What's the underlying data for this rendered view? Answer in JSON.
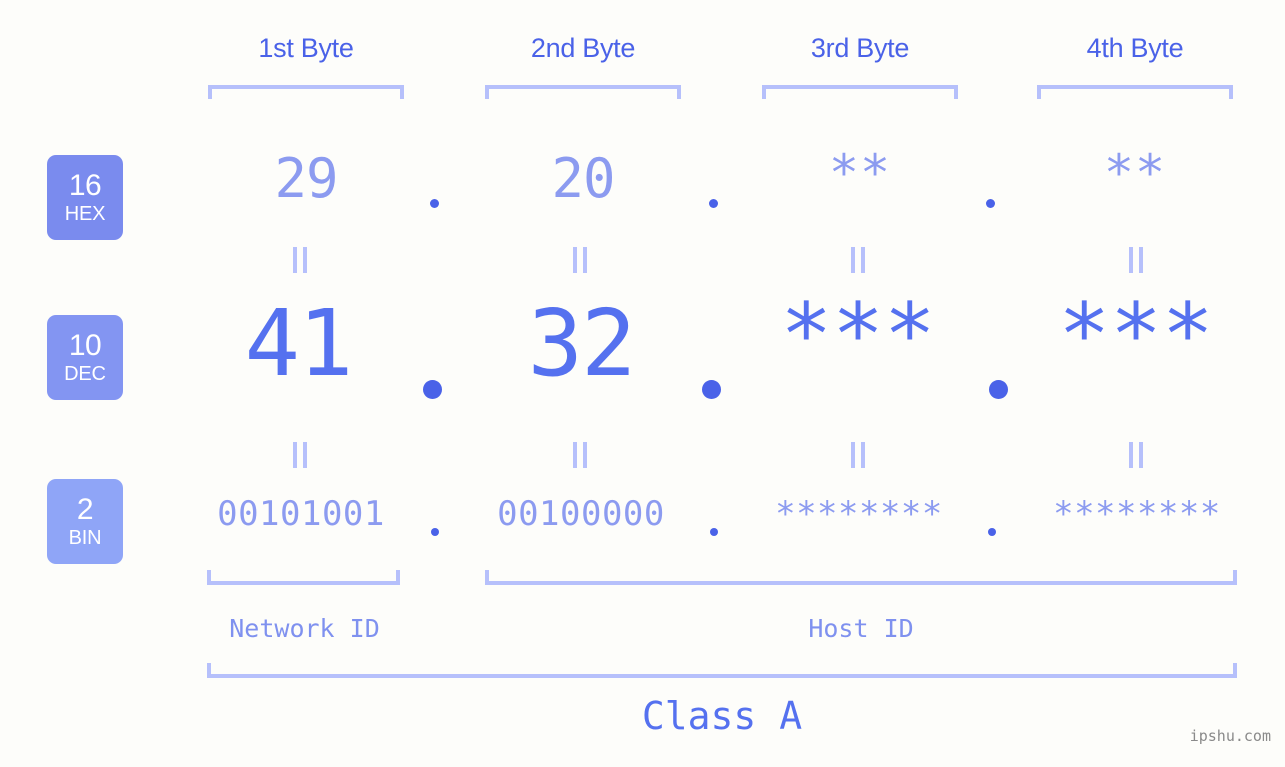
{
  "background_color": "#fdfdfa",
  "accent_colors": {
    "bracket": "#b6c0fb",
    "header_text": "#4a62e8",
    "light_value": "#8c9bf0",
    "strong_value": "#5571ef",
    "badge_hex": "#7a8bee",
    "badge_dec": "#8395f2",
    "badge_bin": "#8fa5f7",
    "watermark": "#8a8a8a"
  },
  "headers": {
    "byte1": "1st Byte",
    "byte2": "2nd Byte",
    "byte3": "3rd Byte",
    "byte4": "4th Byte"
  },
  "radix_badges": [
    {
      "number": "16",
      "word": "HEX"
    },
    {
      "number": "10",
      "word": "DEC"
    },
    {
      "number": "2",
      "word": "BIN"
    }
  ],
  "rows": {
    "hex": {
      "radix": "16",
      "label": "HEX",
      "bytes": [
        "29",
        "20",
        "**",
        "**"
      ],
      "separators": [
        ".",
        ".",
        "."
      ]
    },
    "dec": {
      "radix": "10",
      "label": "DEC",
      "bytes": [
        "41",
        "32",
        "***",
        "***"
      ],
      "separators": [
        ".",
        ".",
        "."
      ]
    },
    "bin": {
      "radix": "2",
      "label": "BIN",
      "bytes": [
        "00101001",
        "00100000",
        "********",
        "********"
      ],
      "separators": [
        ".",
        ".",
        "."
      ]
    }
  },
  "equals_marks": [
    "=",
    "=",
    "=",
    "=",
    "=",
    "=",
    "=",
    "="
  ],
  "footer": {
    "network_id": "Network ID",
    "host_id": "Host ID",
    "class": "Class A"
  },
  "watermark": "ipshu.com",
  "chart_data": {
    "type": "table",
    "title": "IP Address 41.32.*.* byte breakdown",
    "categories": [
      "1st Byte",
      "2nd Byte",
      "3rd Byte",
      "4th Byte"
    ],
    "series": [
      {
        "name": "HEX",
        "values": [
          "29",
          "20",
          "**",
          "**"
        ]
      },
      {
        "name": "DEC",
        "values": [
          "41",
          "32",
          "***",
          "***"
        ]
      },
      {
        "name": "BIN",
        "values": [
          "00101001",
          "00100000",
          "********",
          "********"
        ]
      }
    ],
    "annotations": {
      "network_id_span": [
        "1st Byte"
      ],
      "host_id_span": [
        "2nd Byte",
        "3rd Byte",
        "4th Byte"
      ],
      "class": "Class A"
    }
  }
}
